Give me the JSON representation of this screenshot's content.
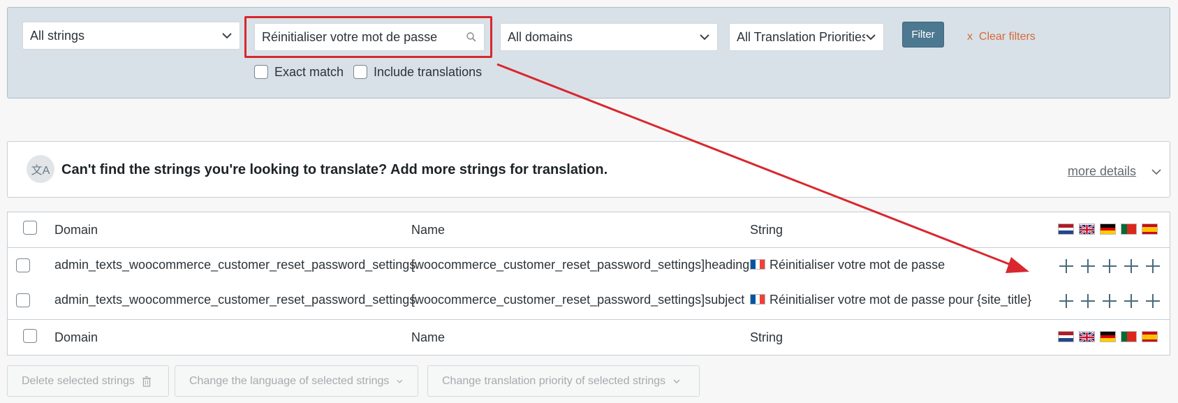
{
  "filters": {
    "string_type": "All strings",
    "search_value": "Réinitialiser votre mot de passe",
    "domain": "All domains",
    "priority": "All Translation Priorities",
    "exact_match_label": "Exact match",
    "include_translations_label": "Include translations",
    "filter_button": "Filter",
    "clear_x": "x",
    "clear_filters": "Clear filters"
  },
  "notice": {
    "icon_text": "文A",
    "text": "Can't find the strings you're looking to translate? Add more strings for translation.",
    "more_details": "more details"
  },
  "table": {
    "headers": {
      "domain": "Domain",
      "name": "Name",
      "string": "String"
    },
    "languages": [
      "nl-flag-icon",
      "en-flag-icon",
      "de-flag-icon",
      "pt-flag-icon",
      "es-flag-icon"
    ],
    "rows": [
      {
        "domain": "admin_texts_woocommerce_customer_reset_password_settings",
        "name": "[woocommerce_customer_reset_password_settings]heading",
        "string": "Réinitialiser votre mot de passe"
      },
      {
        "domain": "admin_texts_woocommerce_customer_reset_password_settings",
        "name": "[woocommerce_customer_reset_password_settings]subject",
        "string": "Réinitialiser votre mot de passe pour {site_title}"
      }
    ]
  },
  "bulk_actions": {
    "delete": "Delete selected strings",
    "change_language": "Change the language of selected strings",
    "change_priority": "Change translation priority of selected strings"
  },
  "colors": {
    "highlight": "#d9272e",
    "filter_button": "#4d7891",
    "clear_link": "#d6683a"
  }
}
